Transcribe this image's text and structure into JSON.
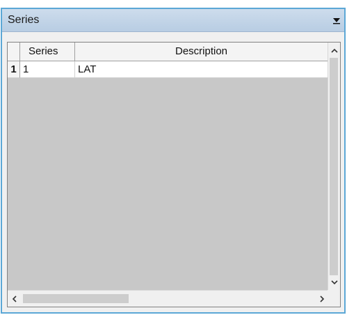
{
  "panel": {
    "title": "Series",
    "dropdown_icon": "dropdown-arrow-icon"
  },
  "grid": {
    "columns": [
      "",
      "Series",
      "Description"
    ],
    "rows": [
      {
        "row_number": "1",
        "series": "1",
        "description": "LAT"
      }
    ]
  },
  "scrollbars": {
    "up_icon": "scroll-up-icon",
    "down_icon": "scroll-down-icon",
    "left_icon": "scroll-left-icon",
    "right_icon": "scroll-right-icon"
  },
  "colors": {
    "panel_border": "#5ba7d6",
    "header_bg": "#c4d6e9",
    "grid_empty_bg": "#c8c8c8",
    "row_bg": "#ffffff"
  }
}
